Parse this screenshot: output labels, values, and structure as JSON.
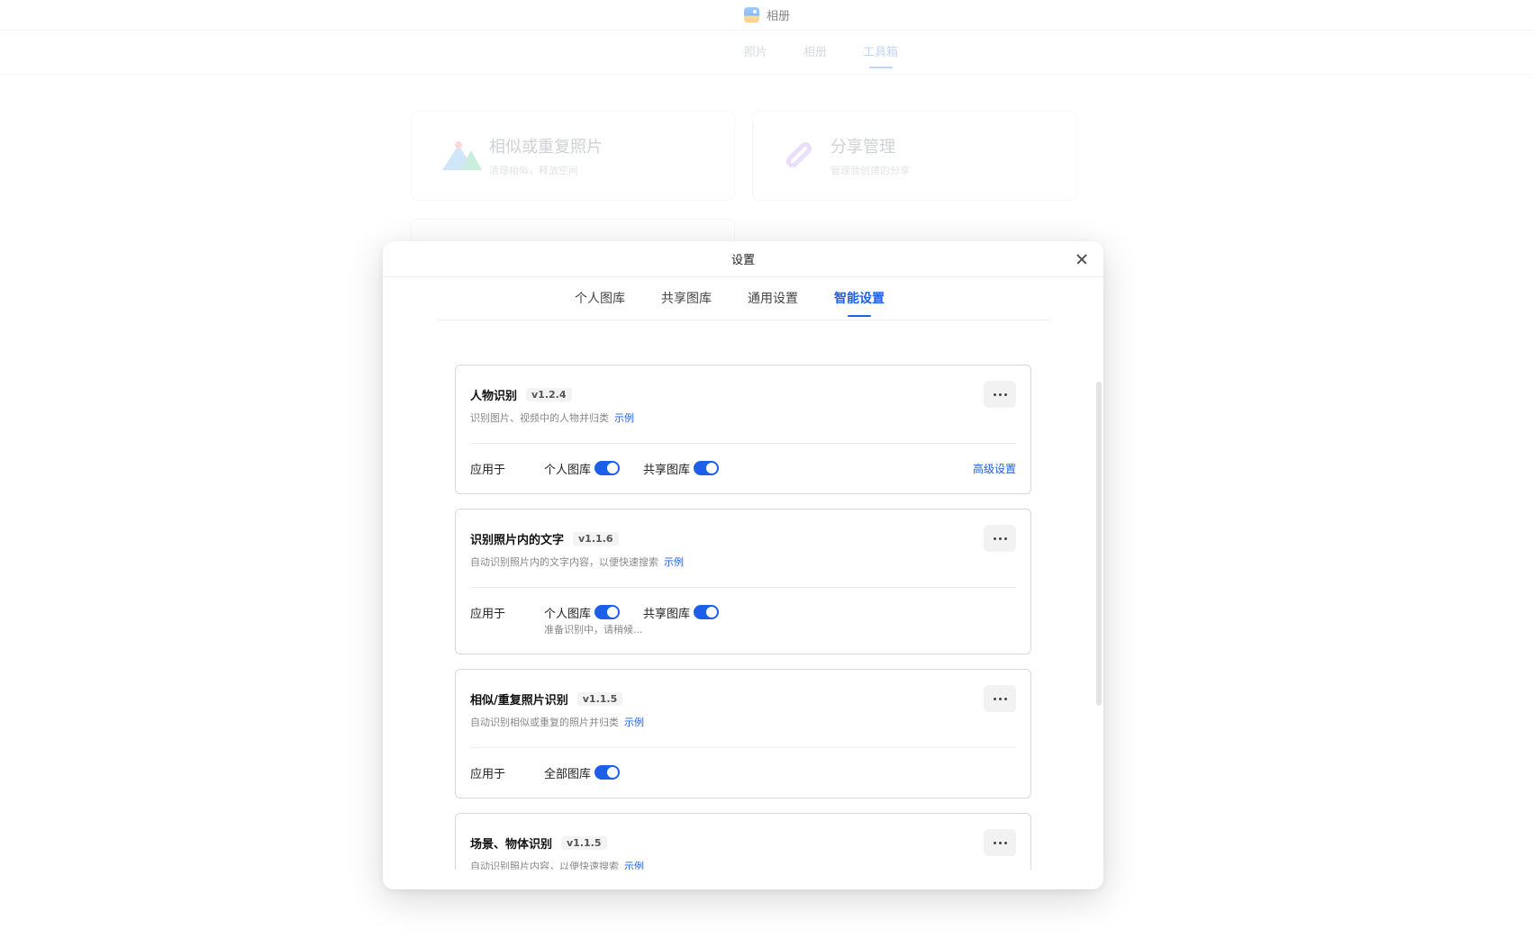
{
  "app": {
    "title": "相册",
    "tabs": [
      {
        "label": "照片"
      },
      {
        "label": "相册"
      },
      {
        "label": "工具箱"
      }
    ]
  },
  "tool_cards": [
    {
      "title": "相似或重复照片",
      "subtitle": "清理相似，释放空间"
    },
    {
      "title": "分享管理",
      "subtitle": "管理我创建的分享"
    }
  ],
  "dialog": {
    "title": "设置",
    "tabs": [
      {
        "label": "个人图库"
      },
      {
        "label": "共享图库"
      },
      {
        "label": "通用设置"
      },
      {
        "label": "智能设置"
      }
    ],
    "apply_label": "应用于",
    "example_label": "示例",
    "features": [
      {
        "title": "人物识别",
        "version": "v1.2.4",
        "desc": "识别图片、视频中的人物并归类",
        "toggles": [
          {
            "label": "个人图库",
            "on": true
          },
          {
            "label": "共享图库",
            "on": true
          }
        ],
        "advanced": "高级设置"
      },
      {
        "title": "识别照片内的文字",
        "version": "v1.1.6",
        "desc": "自动识别照片内的文字内容，以便快速搜索",
        "toggles": [
          {
            "label": "个人图库",
            "on": true
          },
          {
            "label": "共享图库",
            "on": true
          }
        ],
        "status": "准备识别中，请稍候..."
      },
      {
        "title": "相似/重复照片识别",
        "version": "v1.1.5",
        "desc": "自动识别相似或重复的照片并归类",
        "toggles": [
          {
            "label": "全部图库",
            "on": true
          }
        ]
      },
      {
        "title": "场景、物体识别",
        "version": "v1.1.5",
        "desc": "自动识别照片内容，以便快速搜索"
      }
    ]
  },
  "colors": {
    "accent": "#1e5fe8",
    "muted_tab": "#b7bcc4"
  }
}
